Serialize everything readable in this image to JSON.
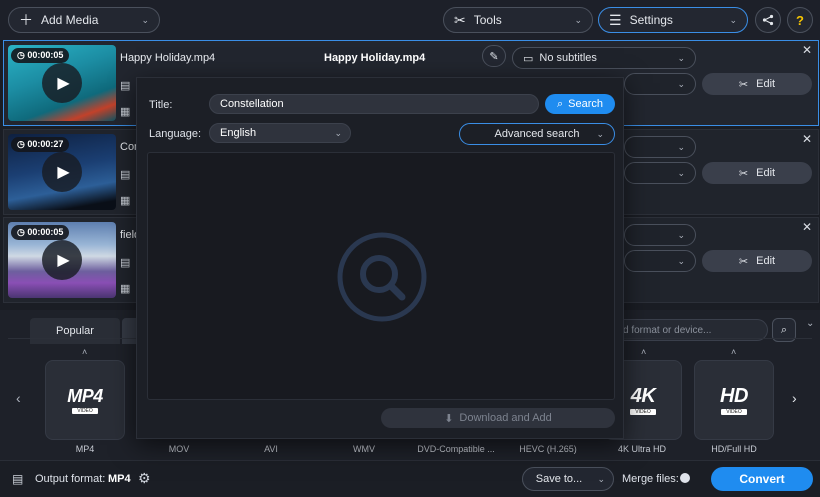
{
  "toolbar": {
    "add_media": "Add Media",
    "tools": "Tools",
    "settings": "Settings",
    "help": "?"
  },
  "files": [
    {
      "duration": "00:00:05",
      "name": "Happy Holiday.mp4",
      "title": "Happy Holiday.mp4",
      "subtitles": "No subtitles",
      "edit": "Edit"
    },
    {
      "duration": "00:00:27",
      "name": "Con",
      "edit": "Edit"
    },
    {
      "duration": "00:00:05",
      "name": "field",
      "edit": "Edit"
    }
  ],
  "modal": {
    "title_label": "Title:",
    "title_value": "Constellation",
    "search": "Search",
    "language_label": "Language:",
    "language_value": "English",
    "advanced_search": "Advanced search",
    "download_add": "Download and Add"
  },
  "formats": {
    "tab_popular": "Popular",
    "search_placeholder": "d format or device...",
    "items": [
      {
        "logo": "MP4",
        "sub": "VIDEO",
        "label": "MP4"
      },
      {
        "label": "MOV"
      },
      {
        "label": "AVI"
      },
      {
        "label": "WMV"
      },
      {
        "label": "DVD-Compatible ..."
      },
      {
        "label": "HEVC (H.265)"
      },
      {
        "logo": "4K",
        "sub": "VIDEO",
        "label": "4K Ultra HD"
      },
      {
        "logo": "HD",
        "sub": "VIDEO",
        "label": "HD/Full HD"
      }
    ]
  },
  "bottom": {
    "output_label": "Output format:",
    "output_value": "MP4",
    "save_to": "Save to...",
    "merge_files": "Merge files:",
    "convert": "Convert"
  },
  "colors": {
    "accent": "#1f8cf0",
    "background": "#1a1d24"
  }
}
